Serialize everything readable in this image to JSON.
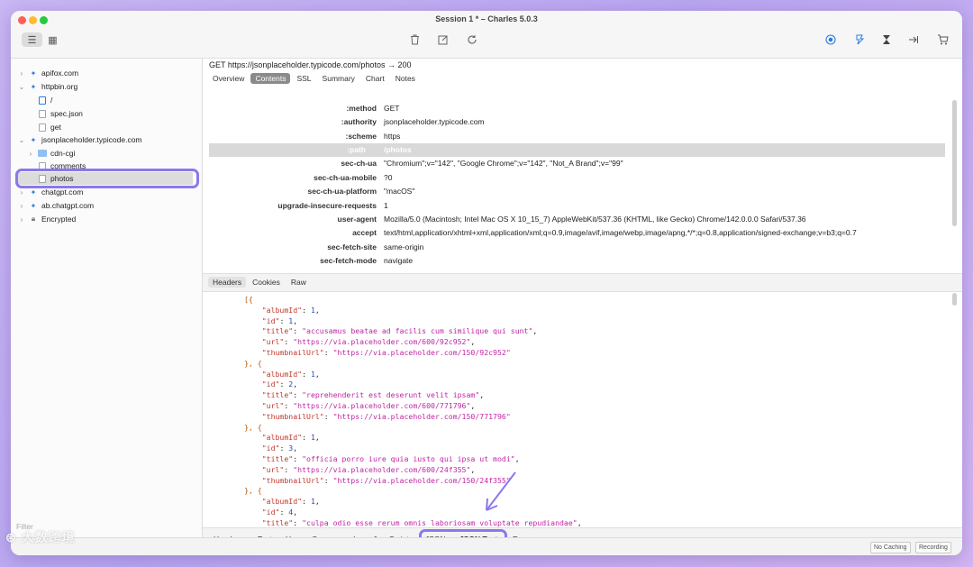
{
  "window": {
    "title": "Session 1 * – Charles 5.0.3"
  },
  "toolbar": {
    "icons": [
      "list-view-icon",
      "table-view-icon",
      "trash-icon",
      "edit-icon",
      "refresh-icon",
      "record-icon",
      "throttle-icon",
      "breakpoint-icon",
      "tools-icon",
      "cart-icon"
    ]
  },
  "sidebar": {
    "items": [
      {
        "label": "apifox.com"
      },
      {
        "label": "httpbin.org"
      },
      {
        "label": "/"
      },
      {
        "label": "spec.json"
      },
      {
        "label": "get"
      },
      {
        "label": "jsonplaceholder.typicode.com"
      },
      {
        "label": "cdn-cgi"
      },
      {
        "label": "comments"
      },
      {
        "label": "photos"
      },
      {
        "label": "chatgpt.com"
      },
      {
        "label": "ab.chatgpt.com"
      },
      {
        "label": "Encrypted"
      }
    ],
    "filter_label": "Filter"
  },
  "request": {
    "line": "GET https://jsonplaceholder.typicode.com/photos → 200"
  },
  "top_tabs": [
    "Overview",
    "Contents",
    "SSL",
    "Summary",
    "Chart",
    "Notes"
  ],
  "top_tabs_active": "Contents",
  "headers": [
    {
      "key": ":method",
      "value": "GET"
    },
    {
      "key": ":authority",
      "value": "jsonplaceholder.typicode.com"
    },
    {
      "key": ":scheme",
      "value": "https"
    },
    {
      "key": ":path",
      "value": "/photos"
    },
    {
      "key": "sec-ch-ua",
      "value": "\"Chromium\";v=\"142\", \"Google Chrome\";v=\"142\", \"Not_A Brand\";v=\"99\""
    },
    {
      "key": "sec-ch-ua-mobile",
      "value": "?0"
    },
    {
      "key": "sec-ch-ua-platform",
      "value": "\"macOS\""
    },
    {
      "key": "upgrade-insecure-requests",
      "value": "1"
    },
    {
      "key": "user-agent",
      "value": "Mozilla/5.0 (Macintosh; Intel Mac OS X 10_15_7) AppleWebKit/537.36 (KHTML, like Gecko) Chrome/142.0.0.0 Safari/537.36"
    },
    {
      "key": "accept",
      "value": "text/html,application/xhtml+xml,application/xml;q=0.9,image/avif,image/webp,image/apng,*/*;q=0.8,application/signed-exchange;v=b3;q=0.7"
    },
    {
      "key": "sec-fetch-site",
      "value": "same-origin"
    },
    {
      "key": "sec-fetch-mode",
      "value": "navigate"
    }
  ],
  "mid_tabs": [
    "Headers",
    "Cookies",
    "Raw"
  ],
  "code_lines": [
    "[{",
    "    \"albumId\": 1,",
    "    \"id\": 1,",
    "    \"title\": \"accusamus beatae ad facilis cum similique qui sunt\",",
    "    \"url\": \"https://via.placeholder.com/600/92c952\",",
    "    \"thumbnailUrl\": \"https://via.placeholder.com/150/92c952\"",
    "}, {",
    "    \"albumId\": 1,",
    "    \"id\": 2,",
    "    \"title\": \"reprehenderit est deserunt velit ipsam\",",
    "    \"url\": \"https://via.placeholder.com/600/771796\",",
    "    \"thumbnailUrl\": \"https://via.placeholder.com/150/771796\"",
    "}, {",
    "    \"albumId\": 1,",
    "    \"id\": 3,",
    "    \"title\": \"officia porro iure quia iusto qui ipsa ut modi\",",
    "    \"url\": \"https://via.placeholder.com/600/24f355\",",
    "    \"thumbnailUrl\": \"https://via.placeholder.com/150/24f355\"",
    "}, {",
    "    \"albumId\": 1,",
    "    \"id\": 4,",
    "    \"title\": \"culpa odio esse rerum omnis laboriosam voluptate repudiandae\","
  ],
  "bottom_tabs": [
    "Headers",
    "Text",
    "Hex",
    "Compressed",
    "JavaScript",
    "JSON",
    "JSON Text",
    "Raw"
  ],
  "status": {
    "no_caching": "No Caching",
    "recording": "Recording"
  },
  "watermark": "大数跨境",
  "colors": {
    "highlight": "#8a78ec",
    "key": "#c0392b",
    "string": "#c026a5",
    "number": "#2a4ab5"
  }
}
